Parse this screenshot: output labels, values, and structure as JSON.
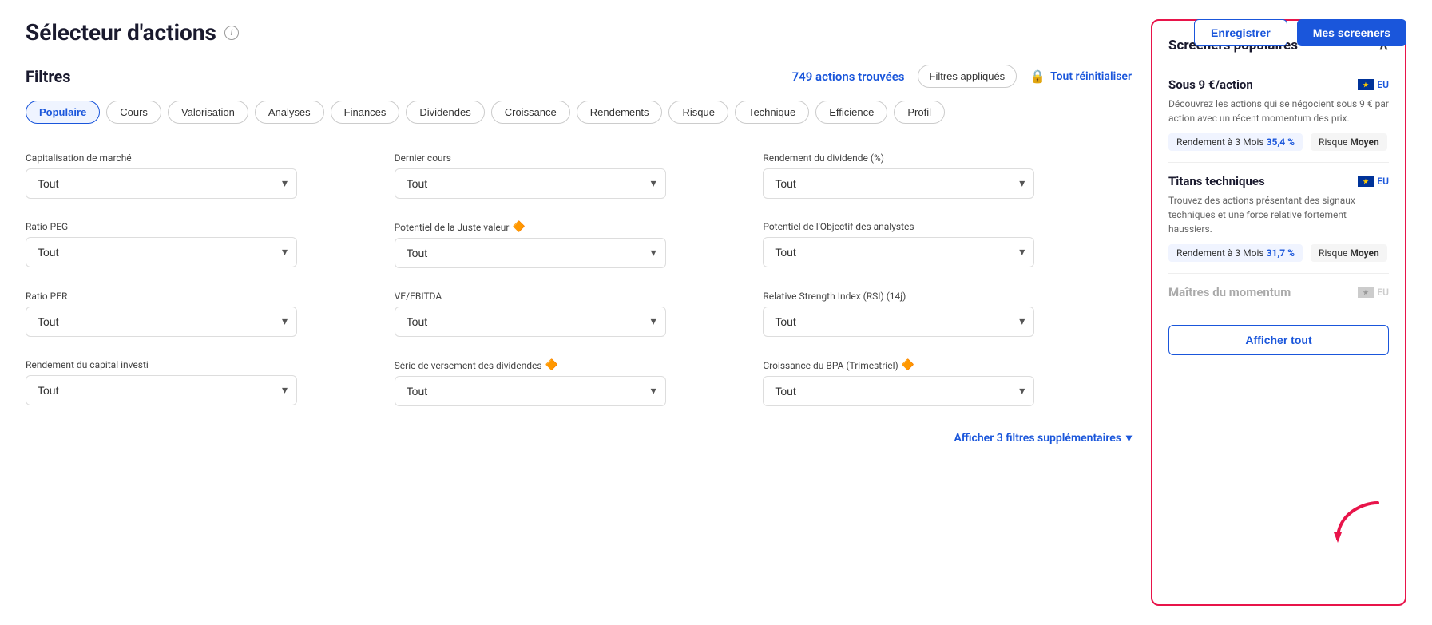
{
  "page": {
    "title": "Sélecteur d'actions",
    "info_icon": "i"
  },
  "header": {
    "save_label": "Enregistrer",
    "my_screeners_label": "Mes screeners"
  },
  "filters": {
    "title": "Filtres",
    "results_count": "749 actions trouvées",
    "applied_label": "Filtres appliqués",
    "reset_label": "Tout réinitialiser"
  },
  "tabs": [
    {
      "label": "Populaire",
      "active": true
    },
    {
      "label": "Cours",
      "active": false
    },
    {
      "label": "Valorisation",
      "active": false
    },
    {
      "label": "Analyses",
      "active": false
    },
    {
      "label": "Finances",
      "active": false
    },
    {
      "label": "Dividendes",
      "active": false
    },
    {
      "label": "Croissance",
      "active": false
    },
    {
      "label": "Rendements",
      "active": false
    },
    {
      "label": "Risque",
      "active": false
    },
    {
      "label": "Technique",
      "active": false
    },
    {
      "label": "Efficience",
      "active": false
    },
    {
      "label": "Profil",
      "active": false
    }
  ],
  "filter_rows": [
    [
      {
        "label": "Capitalisation de marché",
        "value": "Tout",
        "premium": false
      },
      {
        "label": "Dernier cours",
        "value": "Tout",
        "premium": false
      },
      {
        "label": "Rendement du dividende (%)",
        "value": "Tout",
        "premium": false
      }
    ],
    [
      {
        "label": "Ratio PEG",
        "value": "Tout",
        "premium": false
      },
      {
        "label": "Potentiel de la Juste valeur",
        "value": "Tout",
        "premium": true
      },
      {
        "label": "Potentiel de l'Objectif des analystes",
        "value": "Tout",
        "premium": false
      }
    ],
    [
      {
        "label": "Ratio PER",
        "value": "Tout",
        "premium": false
      },
      {
        "label": "VE/EBITDA",
        "value": "Tout",
        "premium": false
      },
      {
        "label": "Relative Strength Index (RSI) (14j)",
        "value": "Tout",
        "premium": false
      }
    ],
    [
      {
        "label": "Rendement du capital investi",
        "value": "Tout",
        "premium": false
      },
      {
        "label": "Série de versement des dividendes",
        "value": "Tout",
        "premium": true
      },
      {
        "label": "Croissance du BPA (Trimestriel)",
        "value": "Tout",
        "premium": true
      }
    ]
  ],
  "show_more": "Afficher 3 filtres supplémentaires",
  "sidebar": {
    "title": "Screeners populaires",
    "screeners": [
      {
        "name": "Sous 9 €/action",
        "region": "EU",
        "desc": "Découvrez les actions qui se négocient sous 9 € par action avec un récent momentum des prix.",
        "stats": [
          {
            "label": "Rendement à 3 Mois",
            "value": "35,4 %",
            "highlighted": true
          },
          {
            "label": "Risque",
            "value": "Moyen",
            "highlighted": false
          }
        ]
      },
      {
        "name": "Titans techniques",
        "region": "EU",
        "desc": "Trouvez des actions présentant des signaux techniques et une force relative fortement haussiers.",
        "stats": [
          {
            "label": "Rendement à 3 Mois",
            "value": "31,7 %",
            "highlighted": true
          },
          {
            "label": "Risque",
            "value": "Moyen",
            "highlighted": false
          }
        ]
      },
      {
        "name": "Maîtres du momentum",
        "region": "EU",
        "dimmed": true,
        "desc": "",
        "stats": []
      }
    ],
    "show_all_label": "Afficher tout"
  }
}
